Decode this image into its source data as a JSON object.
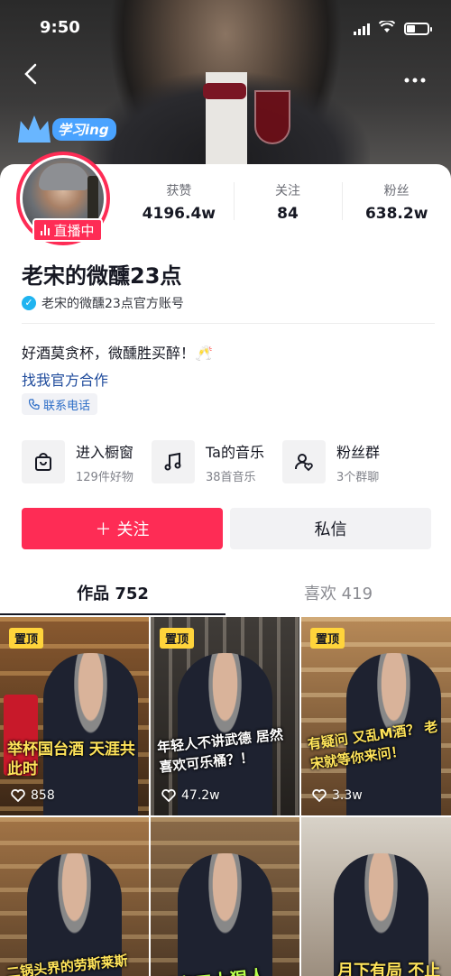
{
  "status": {
    "time": "9:50"
  },
  "profile": {
    "study_badge": "学习ing",
    "live_label": "直播中",
    "name": "老宋的微醺23点",
    "verified_text": "老宋的微醺23点官方账号",
    "bio": "好酒莫贪杯，微醺胜买醉！🥂",
    "coop_link": "找我官方合作",
    "phone_label": "联系电话"
  },
  "stats": [
    {
      "label": "获赞",
      "value": "4196.4w"
    },
    {
      "label": "关注",
      "value": "84"
    },
    {
      "label": "粉丝",
      "value": "638.2w"
    }
  ],
  "features": [
    {
      "title": "进入橱窗",
      "sub": "129件好物",
      "icon": "shopping-bag-icon"
    },
    {
      "title": "Ta的音乐",
      "sub": "38首音乐",
      "icon": "music-note-icon"
    },
    {
      "title": "粉丝群",
      "sub": "3个群聊",
      "icon": "fan-group-icon"
    }
  ],
  "actions": {
    "follow": "关注",
    "message": "私信"
  },
  "tabs": [
    {
      "label": "作品 752",
      "active": true
    },
    {
      "label": "喜欢 419",
      "active": false
    }
  ],
  "videos": [
    {
      "pinned": "置顶",
      "caption": "举杯国台酒 天涯共此时",
      "likes": "858"
    },
    {
      "pinned": "置顶",
      "caption": "年轻人不讲武德 居然喜欢可乐桶？！",
      "likes": "47.2w"
    },
    {
      "pinned": "置顶",
      "caption": "有疑问 又乱M酒？ 老宋就等你来问！",
      "likes": "3.3w"
    },
    {
      "caption": "二锅头界的劳斯莱斯 你喝过吗"
    },
    {
      "caption": "酒桌四大狠人"
    },
    {
      "caption": "月下有局 不止一味"
    }
  ]
}
